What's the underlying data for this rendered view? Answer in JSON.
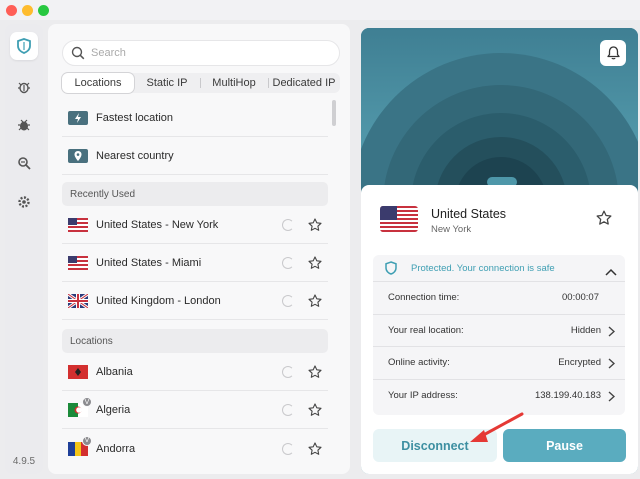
{
  "app": {
    "version": "4.9.5"
  },
  "search": {
    "placeholder": "Search"
  },
  "tabs": [
    {
      "label": "Locations",
      "active": true
    },
    {
      "label": "Static IP"
    },
    {
      "label": "MultiHop"
    },
    {
      "label": "Dedicated IP"
    }
  ],
  "quick": [
    {
      "label": "Fastest location",
      "icon": "lightning-icon"
    },
    {
      "label": "Nearest country",
      "icon": "location-pin-icon"
    }
  ],
  "recent": {
    "header": "Recently Used",
    "items": [
      {
        "label": "United States - New York",
        "flag": "us"
      },
      {
        "label": "United States - Miami",
        "flag": "us"
      },
      {
        "label": "United Kingdom - London",
        "flag": "uk"
      }
    ]
  },
  "locations": {
    "header": "Locations",
    "items": [
      {
        "label": "Albania",
        "flag": "al"
      },
      {
        "label": "Algeria",
        "flag": "dz",
        "badge": "V"
      },
      {
        "label": "Andorra",
        "flag": "ad",
        "badge": "V"
      }
    ]
  },
  "connection": {
    "country": "United States",
    "city": "New York",
    "status": "Protected. Your connection is safe",
    "rows": [
      {
        "label": "Connection time:",
        "value": "00:00:07"
      },
      {
        "label": "Your real location:",
        "value": "Hidden"
      },
      {
        "label": "Online activity:",
        "value": "Encrypted"
      },
      {
        "label": "Your IP address:",
        "value": "138.199.40.183"
      }
    ],
    "disconnect": "Disconnect",
    "pause": "Pause"
  },
  "colors": {
    "accent": "#5aacbf",
    "teal_dark": "#49707e",
    "arrow": "#e53935"
  }
}
